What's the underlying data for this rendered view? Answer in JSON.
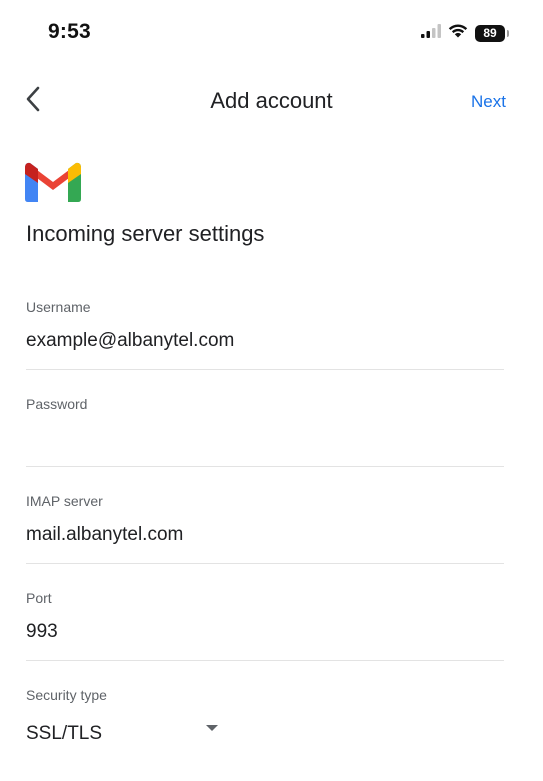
{
  "status_bar": {
    "time": "9:53",
    "battery": "89",
    "icons": [
      "cellular-signal-icon",
      "wifi-icon",
      "battery-icon"
    ]
  },
  "app_bar": {
    "title": "Add account",
    "next_label": "Next",
    "back_icon": "chevron-left-icon"
  },
  "logo": {
    "icon": "gmail-logo-icon",
    "colors": [
      "#4285F4",
      "#EA4335",
      "#FBBC04",
      "#34A853",
      "#C5221F"
    ]
  },
  "page": {
    "section_title": "Incoming server settings"
  },
  "fields": {
    "username": {
      "label": "Username",
      "value": "example@albanytel.com"
    },
    "password": {
      "label": "Password",
      "value": ""
    },
    "imap_server": {
      "label": "IMAP server",
      "value": "mail.albanytel.com"
    },
    "port": {
      "label": "Port",
      "value": "993"
    },
    "security_type": {
      "label": "Security type",
      "value": "SSL/TLS"
    }
  },
  "colors": {
    "accent": "#1a73e8",
    "text_primary": "#202124",
    "text_secondary": "#5f6368",
    "divider": "#e3e3e3"
  }
}
